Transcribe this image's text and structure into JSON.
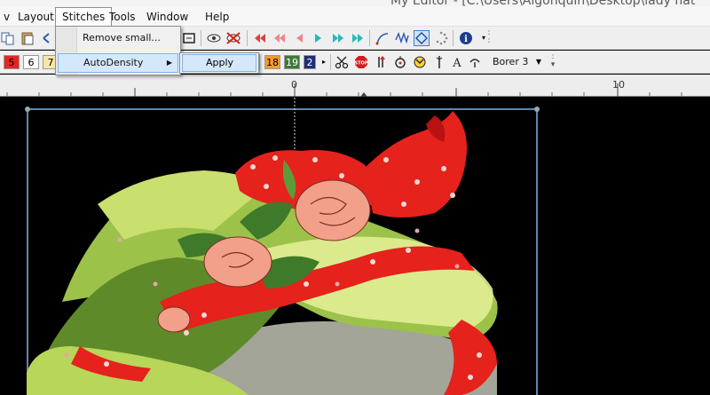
{
  "window": {
    "title": "My Editor - [C:\\Users\\Algonquin\\Desktop\\lady hat"
  },
  "menubar": {
    "items": [
      {
        "label": "v"
      },
      {
        "label": "Layout"
      },
      {
        "label": "Stitches"
      },
      {
        "label": "Tools"
      },
      {
        "label": "Window"
      },
      {
        "label": "Help"
      }
    ]
  },
  "stitches_menu": {
    "items": [
      {
        "label": "Remove small..."
      },
      {
        "label": "AutoDensity"
      }
    ],
    "submenu": {
      "label": "Apply"
    }
  },
  "toolbar2": {
    "colors_left": [
      "5",
      "6",
      "7"
    ],
    "colors_right": [
      "18",
      "19",
      "2"
    ],
    "needle_label": "Borer 3"
  },
  "ruler": {
    "labels": [
      "0",
      "10"
    ]
  },
  "colors": {
    "hat_green": "#9cc24a",
    "brim_light": "#e2ee94",
    "bow_red": "#e5221c",
    "rose_pink": "#f2a08a",
    "selection": "#7fb6e8"
  }
}
